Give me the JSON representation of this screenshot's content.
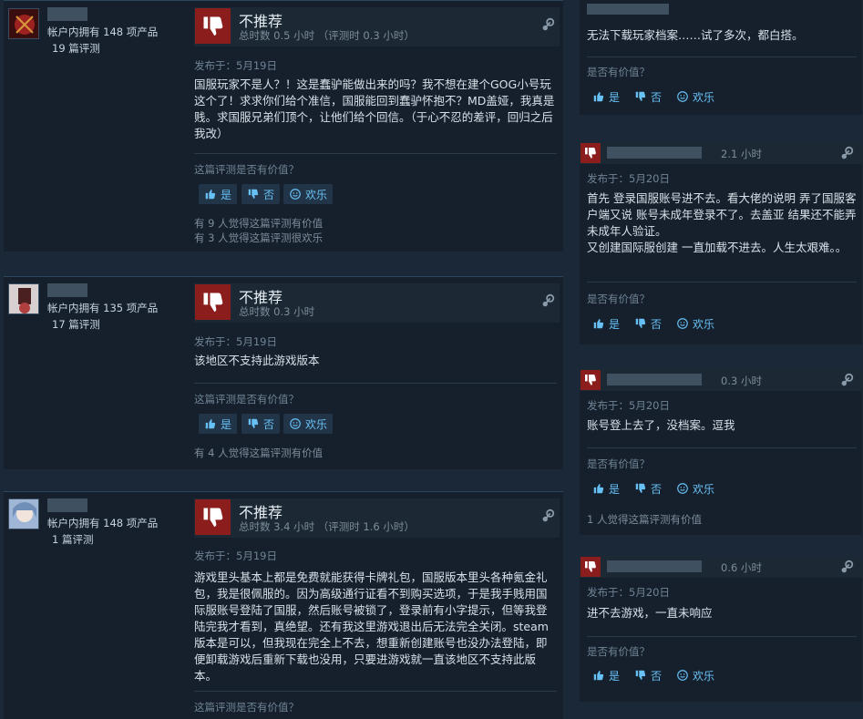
{
  "reviews": [
    {
      "owns": "帐户内拥有 148 项产品",
      "reviews_count": "19 篇评测",
      "verdict": "不推荐",
      "hours": "总时数 0.5 小时 （评测时 0.3 小时）",
      "posted": "发布于：5月19日",
      "body": "国服玩家不是人？！这是蠢驴能做出来的吗？我不想在建个GOG小号玩这个了！求求你们给个准信，国服能回到蠢驴怀抱不？MD盖娅，我真是贱。求国服兄弟们顶个，让他们给个回信。（于心不忍的差评，回归之后我改）",
      "helpful_q": "这篇评测是否有价值？",
      "yes": "是",
      "no": "否",
      "funny": "欢乐",
      "counts": [
        "有 9 人觉得这篇评测有价值",
        "有 3 人觉得这篇评测很欢乐"
      ]
    },
    {
      "owns": "帐户内拥有 135 项产品",
      "reviews_count": "17 篇评测",
      "verdict": "不推荐",
      "hours": "总时数 0.3 小时",
      "posted": "发布于：5月19日",
      "body": "该地区不支持此游戏版本",
      "helpful_q": "这篇评测是否有价值？",
      "yes": "是",
      "no": "否",
      "funny": "欢乐",
      "counts": [
        "有 4 人觉得这篇评测有价值"
      ]
    },
    {
      "owns": "帐户内拥有 148 项产品",
      "reviews_count": "1 篇评测",
      "verdict": "不推荐",
      "hours": "总时数 3.4 小时 （评测时 1.6 小时）",
      "posted": "发布于：5月19日",
      "body": "游戏里头基本上都是免费就能获得卡牌礼包，国服版本里头各种氪金礼包，我是很佩服的。因为高级通行证看不到购买选项，于是我手贱用国际服账号登陆了国服，然后账号被锁了，登录前有小字提示，但等我登陆完我才看到，真绝望。还有我这里游戏退出后无法完全关闭。steam版本是可以，但我现在完全上不去，想重新创建账号也没办法登陆，即便卸载游戏后重新下载也没用，只要进游戏就一直该地区不支持此版本。",
      "helpful_q": "这篇评测是否有价值？"
    }
  ],
  "side_reviews": [
    {
      "hours": "",
      "posted": "",
      "body": "无法下载玩家档案……试了多次，都白搭。",
      "helpful_q": "是否有价值？",
      "yes": "是",
      "no": "否",
      "funny": "欢乐"
    },
    {
      "hours": "2.1 小时",
      "posted": "发布于：5月20日",
      "body": "首先 登录国服账号进不去。看大佬的说明 弄了国服客户端又说 账号未成年登录不了。去盖亚 结果还不能弄未成年人验证。\n又创建国际服创建 一直加载不进去。人生太艰难。。",
      "helpful_q": "是否有价值？",
      "yes": "是",
      "no": "否",
      "funny": "欢乐"
    },
    {
      "hours": "0.3 小时",
      "posted": "发布于：5月20日",
      "body": "账号登上去了，没档案。逗我",
      "helpful_q": "是否有价值？",
      "yes": "是",
      "no": "否",
      "funny": "欢乐",
      "count": "1 人觉得这篇评测有价值"
    },
    {
      "hours": "0.6 小时",
      "posted": "发布于：5月20日",
      "body": "进不去游戏，一直未响应",
      "helpful_q": "是否有价值？",
      "yes": "是",
      "no": "否",
      "funny": "欢乐"
    }
  ],
  "colors": {
    "thumb_down_bg": "#8b1d1d",
    "link": "#67c1f5",
    "bg": "#1b2838"
  }
}
